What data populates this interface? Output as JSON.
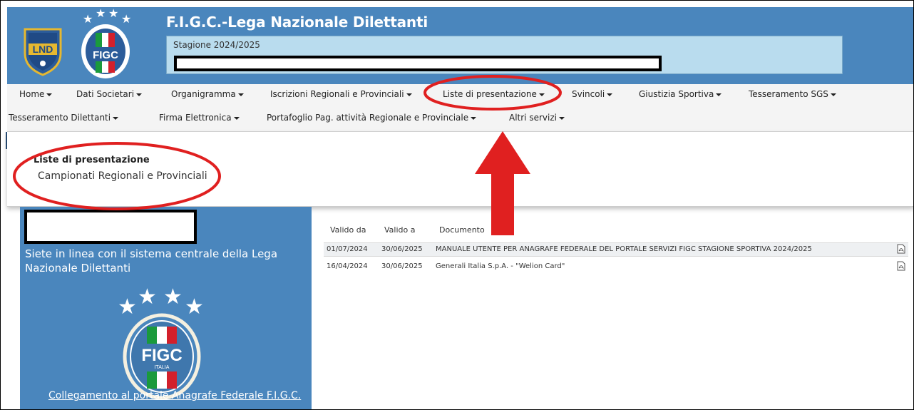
{
  "header": {
    "title": "F.I.G.C.-Lega Nazionale Dilettanti",
    "season": "Stagione 2024/2025",
    "logo_lnd_text": "LND",
    "logo_figc_text": "FIGC"
  },
  "nav": {
    "row1": [
      "Home",
      "Dati Societari",
      "Organigramma",
      "Iscrizioni Regionali e Provinciali",
      "Liste di presentazione",
      "Svincoli",
      "Giustizia Sportiva",
      "Tesseramento SGS"
    ],
    "row2": [
      "Tesseramento Dilettanti",
      "Firma Elettronica",
      "Portafoglio Pag. attività Regionale e Provinciale",
      "Altri servizi"
    ]
  },
  "dropdown": {
    "header": "Liste di presentazione",
    "items": [
      "Campionati Regionali e Provinciali"
    ]
  },
  "sidebar": {
    "online_text": "Siete in linea con il sistema centrale della Lega Nazionale Dilettanti",
    "logo_text": "FIGC",
    "logo_subtext": "ITALIA",
    "link": "Collegamento al portale Anagrafe Federale F.I.G.C."
  },
  "documents": {
    "columns": [
      "Valido da",
      "Valido a",
      "Documento"
    ],
    "rows": [
      {
        "valid_from": "01/07/2024",
        "valid_to": "30/06/2025",
        "document": "MANUALE UTENTE PER ANAGRAFE FEDERALE DEL PORTALE SERVIZI FIGC STAGIONE SPORTIVA 2024/2025"
      },
      {
        "valid_from": "16/04/2024",
        "valid_to": "30/06/2025",
        "document": "Generali Italia S.p.A. - \"Welion Card\""
      }
    ]
  },
  "colors": {
    "brand_blue": "#4a86bd",
    "season_bg": "#b9dcee",
    "annotation_red": "#e02020"
  },
  "icons": [
    "caret-down-icon",
    "pdf-icon",
    "lnd-logo",
    "figc-logo",
    "red-arrow-annotation",
    "red-ellipse-annotation"
  ]
}
